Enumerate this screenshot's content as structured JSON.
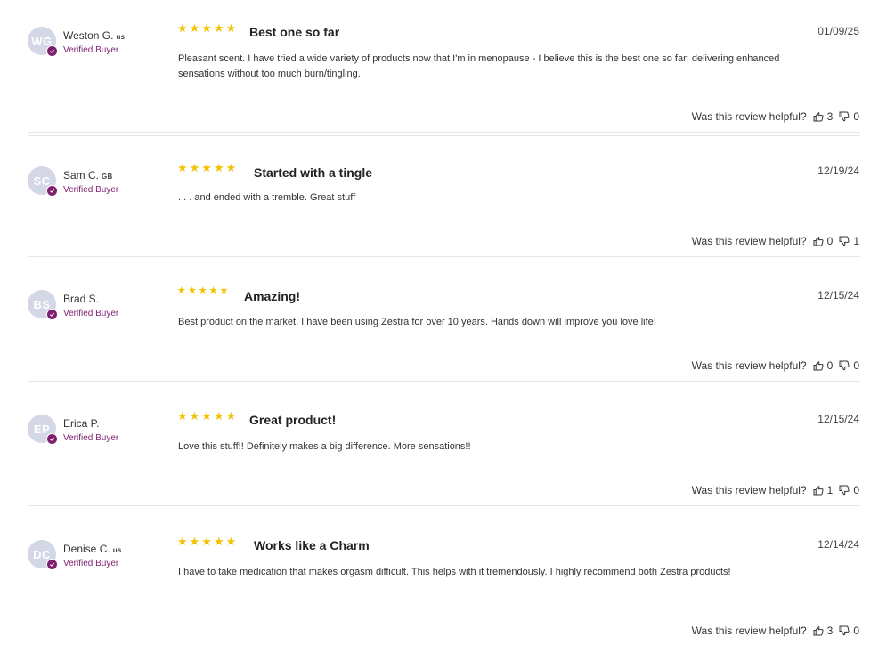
{
  "helpful_prompt": "Was this review helpful?",
  "accent_color": "#7d1f6e",
  "star_color": "#f2c200",
  "reviews": [
    {
      "initials": "WG",
      "name": "Weston G.",
      "country": "us",
      "verified": "Verified Buyer",
      "stars": "★★★★★",
      "rating": 5,
      "title": "Best one so far",
      "date": "01/09/25",
      "body": "Pleasant scent. I have tried a wide variety of products now that I'm in menopause - I believe this is the best one so far; delivering enhanced sensations without too much burn/tingling.",
      "up": "3",
      "down": "0"
    },
    {
      "initials": "SC",
      "name": "Sam C.",
      "country": "GB",
      "verified": "Verified Buyer",
      "stars": "★★★★★",
      "rating": 5,
      "title": "Started with a tingle",
      "date": "12/19/24",
      "body": ". . . and ended with a tremble. Great stuff",
      "up": "0",
      "down": "1"
    },
    {
      "initials": "BS",
      "name": "Brad S.",
      "country": "",
      "verified": "Verified Buyer",
      "stars": "★★★★★",
      "rating": 5,
      "title": "Amazing!",
      "date": "12/15/24",
      "body": "Best product on the market. I have been using Zestra for over 10 years. Hands down will improve you love life!",
      "up": "0",
      "down": "0"
    },
    {
      "initials": "EP",
      "name": "Erica P.",
      "country": "",
      "verified": "Verified Buyer",
      "stars": "★★★★★",
      "rating": 5,
      "title": "Great product!",
      "date": "12/15/24",
      "body": "Love this stuff!! Definitely makes a big difference. More sensations!!",
      "up": "1",
      "down": "0"
    },
    {
      "initials": "DC",
      "name": "Denise C.",
      "country": "us",
      "verified": "Verified Buyer",
      "stars": "★★★★★",
      "rating": 5,
      "title": "Works like a Charm",
      "date": "12/14/24",
      "body": "I have to take medication that makes orgasm difficult. This helps with it tremendously. I highly recommend both Zestra products!",
      "up": "3",
      "down": "0"
    }
  ]
}
